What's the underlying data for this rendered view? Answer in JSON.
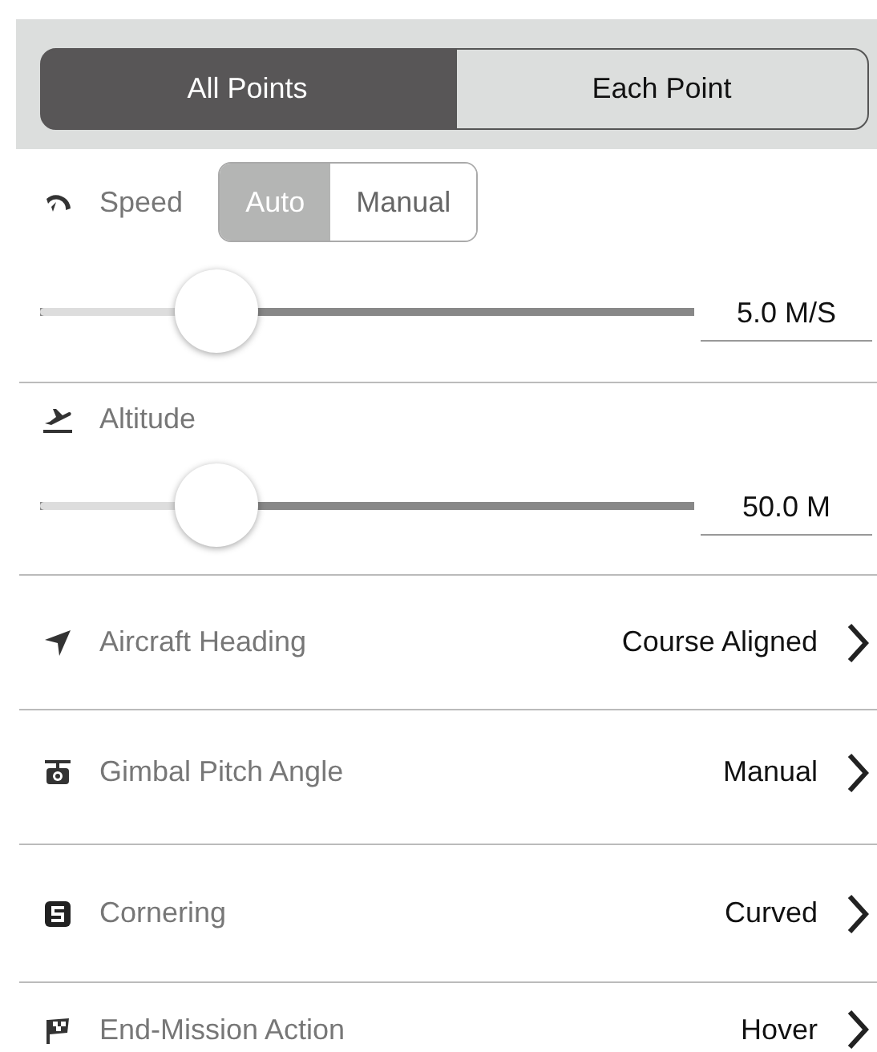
{
  "mode_tabs": [
    {
      "label": "All Points",
      "selected": true
    },
    {
      "label": "Each Point",
      "selected": false
    }
  ],
  "speed": {
    "label": "Speed",
    "modes": [
      {
        "label": "Auto",
        "selected": true
      },
      {
        "label": "Manual",
        "selected": false
      }
    ],
    "level": 0.27,
    "reading": "5.0 M/S"
  },
  "altitude": {
    "label": "Altitude",
    "level": 0.27,
    "reading": "50.0 M"
  },
  "settings": [
    {
      "label": "Aircraft Heading",
      "value": "Course Aligned"
    },
    {
      "label": "Gimbal Pitch Angle",
      "value": "Manual"
    },
    {
      "label": "Cornering",
      "value": "Curved"
    },
    {
      "label": "End-Mission Action",
      "value": "Hover"
    }
  ]
}
